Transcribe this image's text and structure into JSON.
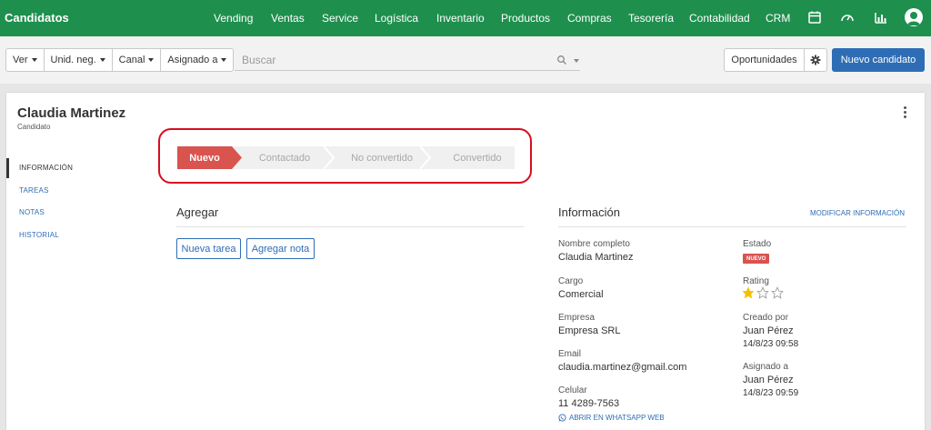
{
  "app": {
    "title": "Candidatos",
    "nav": [
      "Vending",
      "Ventas",
      "Service",
      "Logística",
      "Inventario",
      "Productos",
      "Compras",
      "Tesorería",
      "Contabilidad",
      "CRM"
    ],
    "icons": [
      "calendar-icon",
      "dashboard-gauge-icon",
      "bar-chart-icon",
      "user-avatar-icon"
    ]
  },
  "filters": {
    "buttons": [
      "Ver",
      "Unid. neg.",
      "Canal",
      "Asignado a"
    ],
    "search_placeholder": "Buscar",
    "opportunities_label": "Oportunidades",
    "new_label": "Nuevo candidato"
  },
  "record": {
    "name": "Claudia Martinez",
    "type": "Candidato"
  },
  "side_menu": {
    "items": [
      "INFORMACIÓN",
      "TAREAS",
      "NOTAS",
      "HISTORIAL"
    ],
    "active_index": 0
  },
  "status_path": {
    "steps": [
      "Nuevo",
      "Contactado",
      "No convertido",
      "Convertido"
    ],
    "active_index": 0
  },
  "add_section": {
    "title": "Agregar",
    "task_label": "Nueva tarea",
    "note_label": "Agregar nota"
  },
  "info": {
    "title": "Información",
    "modify_label": "MODIFICAR INFORMACIÓN",
    "full_name_label": "Nombre completo",
    "full_name": "Claudia Martinez",
    "role_label": "Cargo",
    "role": "Comercial",
    "company_label": "Empresa",
    "company": "Empresa SRL",
    "email_label": "Email",
    "email": "claudia.martinez@gmail.com",
    "phone_label": "Celular",
    "phone": "11 4289-7563",
    "whatsapp_label": "ABRIR EN WHATSAPP WEB",
    "status_label": "Estado",
    "status": "NUEVO",
    "rating_label": "Rating",
    "rating": 1,
    "rating_max": 3,
    "created_label": "Creado por",
    "created_by": "Juan Pérez",
    "created_at": "14/8/23 09:58",
    "assigned_label": "Asignado a",
    "assigned_to": "Juan Pérez",
    "assigned_at": "14/8/23 09:59"
  },
  "colors": {
    "nav_bg": "#1f8f4e",
    "primary": "#2e6db5",
    "status_active": "#d9534f",
    "highlight_border": "#d90d1e",
    "star": "#f2c200"
  }
}
